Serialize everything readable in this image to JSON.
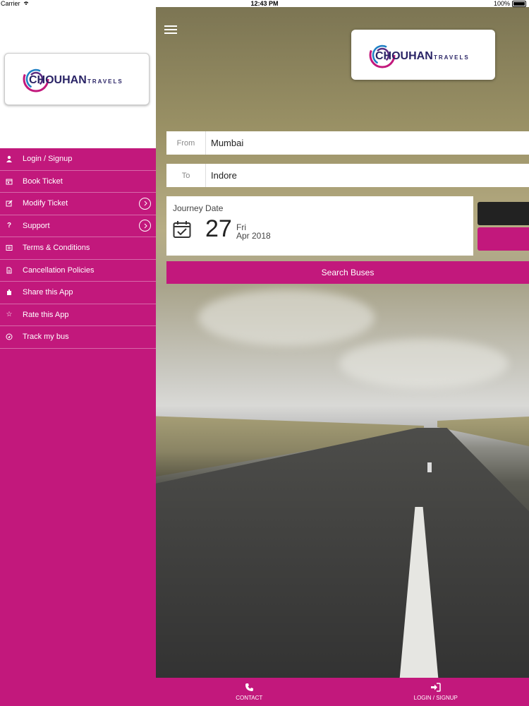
{
  "status_bar": {
    "carrier": "Carrier",
    "time": "12:43 PM",
    "battery": "100%"
  },
  "brand": {
    "name": "CHOUHAN",
    "suffix": "TRAVELS"
  },
  "colors": {
    "accent": "#c2187c",
    "dark_button": "#222222"
  },
  "sidebar": {
    "items": [
      {
        "label": "Login / Signup",
        "icon": "user-icon"
      },
      {
        "label": "Book Ticket",
        "icon": "calendar-icon"
      },
      {
        "label": "Modify Ticket",
        "icon": "edit-icon",
        "chevron": true
      },
      {
        "label": "Support",
        "icon": "question-icon",
        "chevron": true
      },
      {
        "label": "Terms & Conditions",
        "icon": "document-icon"
      },
      {
        "label": "Cancellation Policies",
        "icon": "file-icon"
      },
      {
        "label": "Share this App",
        "icon": "share-icon"
      },
      {
        "label": "Rate this App",
        "icon": "star-icon"
      },
      {
        "label": "Track my bus",
        "icon": "location-icon"
      }
    ]
  },
  "search": {
    "from_label": "From",
    "from_value": "Mumbai",
    "to_label": "To",
    "to_value": "Indore",
    "journey_label": "Journey Date",
    "day": "27",
    "weekday": "Fri",
    "month_year": "Apr 2018",
    "button": "Search Buses"
  },
  "bottom_bar": {
    "contact": "CONTACT",
    "login": "LOGIN / SIGNUP"
  }
}
